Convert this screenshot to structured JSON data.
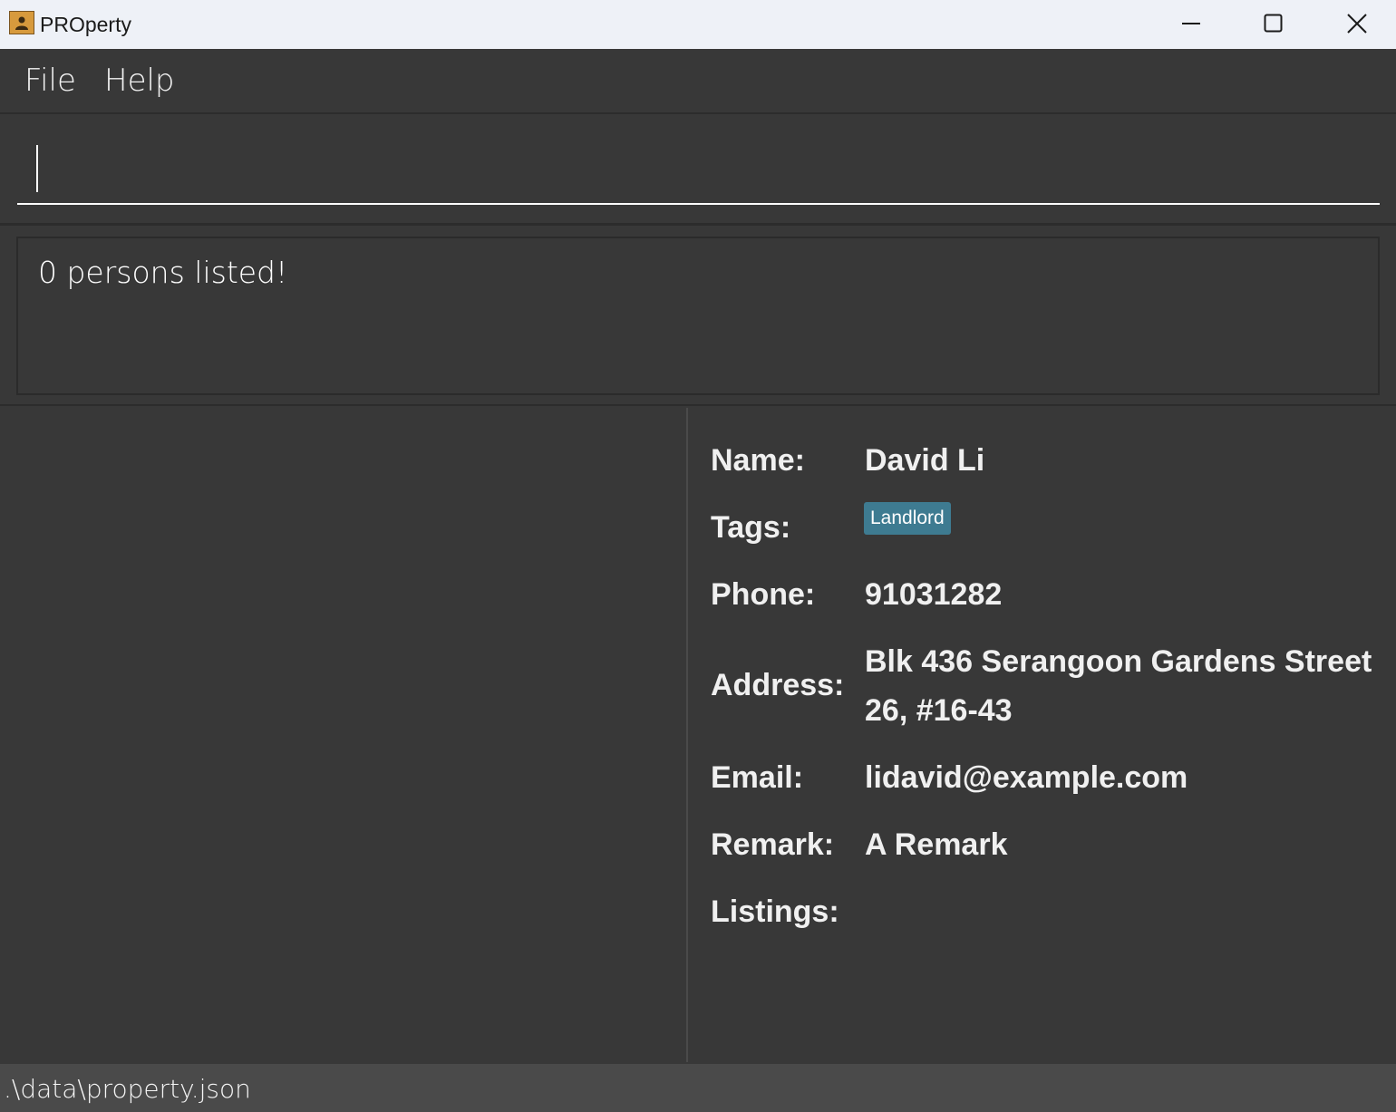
{
  "window": {
    "title": "PROperty",
    "controls": [
      "minimize-icon",
      "maximize-icon",
      "close-icon"
    ]
  },
  "menu": {
    "items": [
      "File",
      "Help"
    ]
  },
  "command_box": {
    "value": "",
    "placeholder": ""
  },
  "result": {
    "message": "0 persons listed!"
  },
  "person_list": {
    "items": []
  },
  "details": {
    "labels": {
      "name": "Name:",
      "tags": "Tags:",
      "phone": "Phone:",
      "address": "Address:",
      "email": "Email:",
      "remark": "Remark:",
      "listings": "Listings:"
    },
    "name": "David Li",
    "tags": [
      "Landlord"
    ],
    "phone": "91031282",
    "address": "Blk 436 Serangoon Gardens Street 26, #16-43",
    "email": "lidavid@example.com",
    "remark": "A Remark",
    "listings": []
  },
  "status_bar": {
    "path": ".\\data\\property.json"
  },
  "colors": {
    "background": "#383838",
    "titlebar": "#eef1f7",
    "tag": "#3e7b91",
    "statusbar": "#4a4a4a"
  }
}
